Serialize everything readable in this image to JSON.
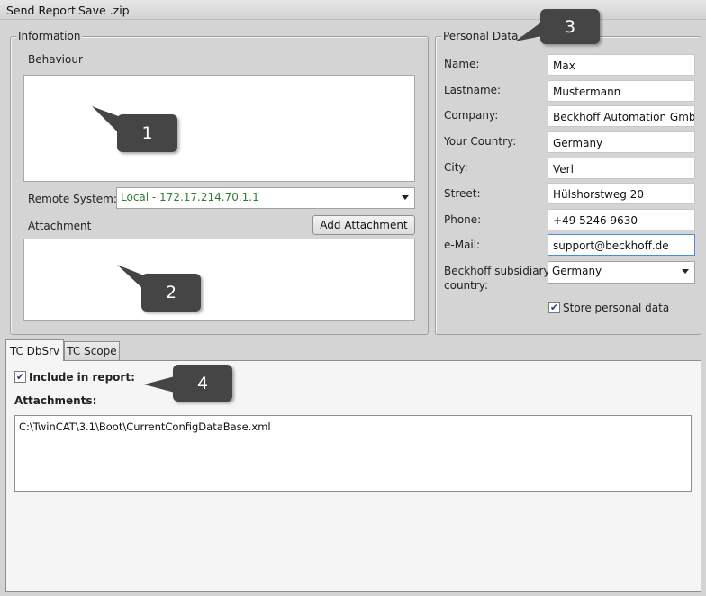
{
  "menu": {
    "send_report": "Send Report",
    "save_zip": "Save .zip"
  },
  "information": {
    "legend": "Information",
    "behaviour_label": "Behaviour",
    "remote_system_label": "Remote System:",
    "remote_system_value": "Local - 172.17.214.70.1.1",
    "attachment_label": "Attachment",
    "add_attachment_button": "Add Attachment"
  },
  "personal_data": {
    "legend": "Personal Data",
    "fields": [
      {
        "label": "Name:",
        "value": "Max"
      },
      {
        "label": "Lastname:",
        "value": "Mustermann"
      },
      {
        "label": "Company:",
        "value": "Beckhoff Automation GmbH"
      },
      {
        "label": "Your Country:",
        "value": "Germany"
      },
      {
        "label": "City:",
        "value": "Verl"
      },
      {
        "label": "Street:",
        "value": "Hülshorstweg 20"
      },
      {
        "label": "Phone:",
        "value": "+49 5246 9630"
      },
      {
        "label": "e-Mail:",
        "value": "support@beckhoff.de"
      }
    ],
    "subsidiary_label_line1": "Beckhoff subsidiary",
    "subsidiary_label_line2": "country:",
    "subsidiary_value": "Germany",
    "store_label": "Store personal data",
    "store_checked": true
  },
  "tabs": [
    {
      "label": "TC DbSrv",
      "active": true
    },
    {
      "label": "TC Scope",
      "active": false
    }
  ],
  "tab_content": {
    "include_label": "Include in report:",
    "include_checked": true,
    "attachments_label": "Attachments:",
    "attachment_path": "C:\\TwinCAT\\3.1\\Boot\\CurrentConfigDataBase.xml"
  },
  "callouts": [
    "1",
    "2",
    "3",
    "4"
  ],
  "colors": {
    "remote_value": "#2e7d32",
    "callout_bg": "#454545",
    "focus_border": "#4a8cd6"
  },
  "icons": [
    "checkmark-icon",
    "chevron-down-icon"
  ]
}
